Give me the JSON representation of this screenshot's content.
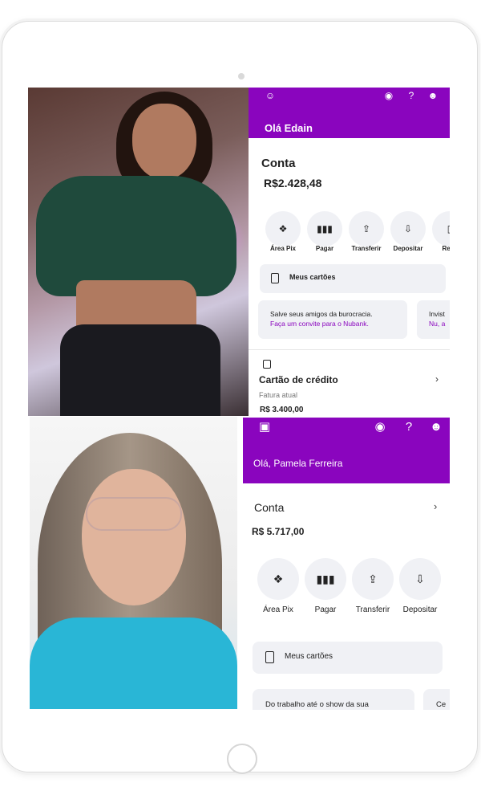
{
  "brand_color": "#8a05be",
  "screen_top": {
    "greeting": "Olá Edain",
    "conta_label": "Conta",
    "balance": "R$2.428,48",
    "header_icons": [
      "profile-icon",
      "eye-icon",
      "help-icon",
      "add-user-icon"
    ],
    "actions": [
      {
        "label": "Área Pix",
        "icon": "pix-icon"
      },
      {
        "label": "Pagar",
        "icon": "barcode-icon"
      },
      {
        "label": "Transferir",
        "icon": "transfer-icon"
      },
      {
        "label": "Depositar",
        "icon": "deposit-icon"
      },
      {
        "label": "Reca",
        "icon": "phone-icon"
      }
    ],
    "cards_label": "Meus cartões",
    "promo_1": {
      "line1": "Salve seus amigos da burocracia.",
      "line2": "Faça um convite para o Nubank."
    },
    "promo_2": {
      "line1": "Invist",
      "line2": "Nu, a"
    },
    "credit_title": "Cartão de crédito",
    "credit_sub": "Fatura atual",
    "credit_value": "R$ 3.400,00"
  },
  "screen_bottom": {
    "greeting": "Olá, Pamela Ferreira",
    "conta_label": "Conta",
    "balance": "R$ 5.717,00",
    "header_icons": [
      "add-photo-icon",
      "eye-icon",
      "help-icon",
      "add-user-icon"
    ],
    "actions": [
      {
        "label": "Área Pix",
        "icon": "pix-icon"
      },
      {
        "label": "Pagar",
        "icon": "barcode-icon"
      },
      {
        "label": "Transferir",
        "icon": "transfer-icon"
      },
      {
        "label": "Depositar",
        "icon": "deposit-icon"
      }
    ],
    "cards_label": "Meus cartões",
    "promo_1": {
      "line1": "Do trabalho até o show da sua"
    },
    "promo_2": {
      "line1": "Ce"
    }
  }
}
